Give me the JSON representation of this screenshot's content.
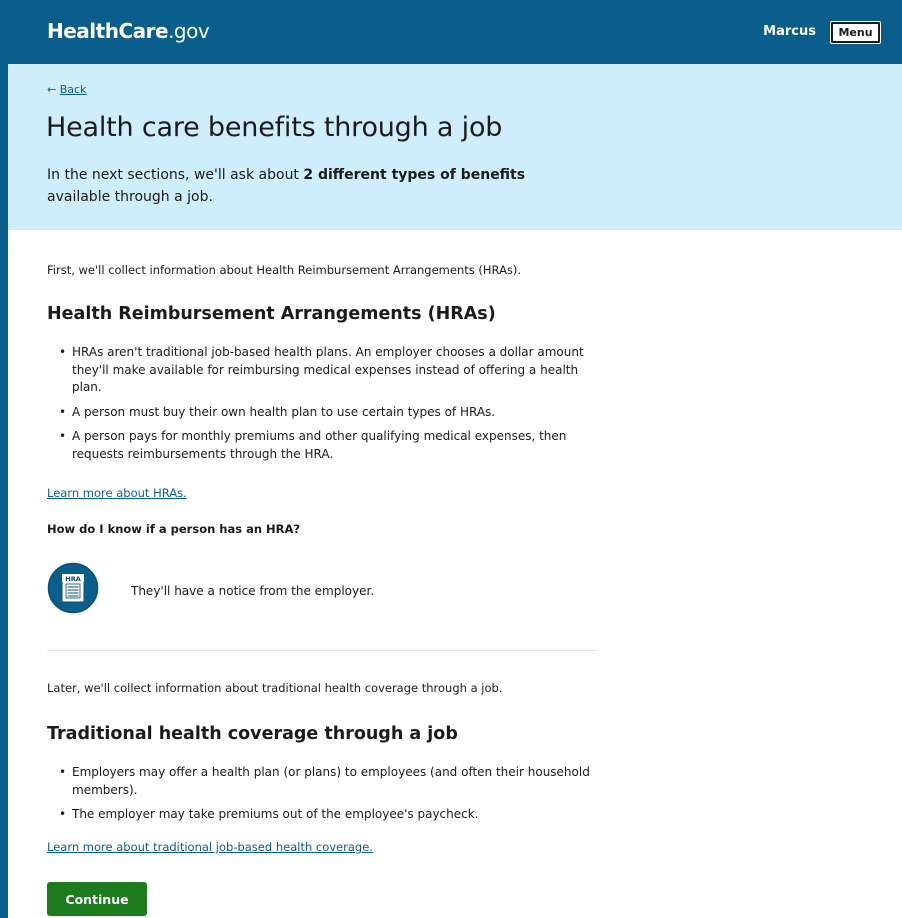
{
  "header": {
    "logo_main": "HealthCare",
    "logo_suffix": ".gov",
    "user_name": "Marcus",
    "menu_label": "Menu"
  },
  "hero": {
    "back_arrow": "←",
    "back_label": "Back",
    "title": "Health care benefits through a job",
    "intro_before": "In the next sections, we'll ask about ",
    "intro_bold": "2 different types of benefits",
    "intro_after": " available through a job."
  },
  "hra_section": {
    "lead": "First, we'll collect information about Health Reimbursement Arrangements (HRAs).",
    "heading": "Health Reimbursement Arrangements (HRAs)",
    "bullets": [
      "HRAs aren't traditional job-based health plans. An employer chooses a dollar amount they'll make available for reimbursing medical expenses instead of offering a health plan.",
      "A person must buy their own health plan to use certain types of HRAs.",
      "A person pays for monthly premiums and other qualifying medical expenses, then requests reimbursements through the HRA."
    ],
    "learn_more": "Learn more about HRAs.",
    "question": "How do I know if a person has an HRA?",
    "icon_label": "HRA",
    "icon_name": "hra-document-icon",
    "answer": "They'll have a notice from the employer."
  },
  "traditional_section": {
    "lead": "Later, we'll collect information about traditional health coverage through a job.",
    "heading": "Traditional health coverage through a job",
    "bullets": [
      "Employers may offer a health plan (or plans) to employees (and often their household members).",
      "The employer may take premiums out of the employee's paycheck."
    ],
    "learn_more": "Learn more about traditional job-based health coverage."
  },
  "continue_label": "Continue",
  "colors": {
    "header_bg": "#0a5e8c",
    "hero_bg": "#cfeefc",
    "link": "#0b5e8c",
    "continue_bg": "#1d7a1d"
  }
}
